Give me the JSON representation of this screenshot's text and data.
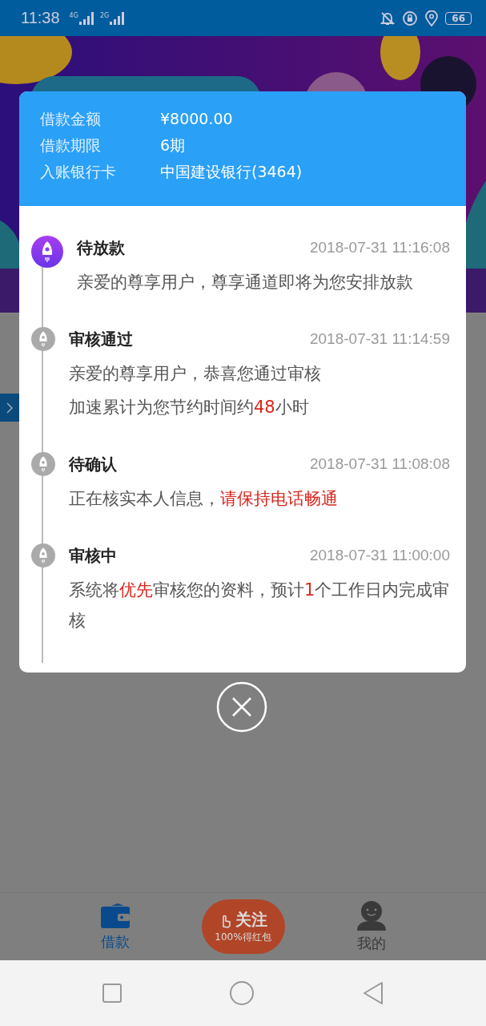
{
  "status_bar": {
    "time": "11:38",
    "signals": [
      "4G",
      "2G"
    ],
    "battery": "66"
  },
  "loan_dialog": {
    "summary": [
      {
        "label": "借款金额",
        "value": "¥8000.00"
      },
      {
        "label": "借款期限",
        "value": "6期"
      },
      {
        "label": "入账银行卡",
        "value": "中国建设银行(3464)"
      }
    ],
    "timeline": [
      {
        "title": "待放款",
        "time": "2018-07-31 11:16:08",
        "active": true,
        "lines": [
          [
            {
              "text": "亲爱的尊享用户，尊享通道即将为您安排放款",
              "highlight": false
            }
          ]
        ]
      },
      {
        "title": "审核通过",
        "time": "2018-07-31 11:14:59",
        "active": false,
        "lines": [
          [
            {
              "text": "亲爱的尊享用户，恭喜您通过审核",
              "highlight": false
            }
          ],
          [
            {
              "text": "加速累计为您节约时间约",
              "highlight": false
            },
            {
              "text": "48",
              "highlight": true
            },
            {
              "text": "小时",
              "highlight": false
            }
          ]
        ]
      },
      {
        "title": "待确认",
        "time": "2018-07-31 11:08:08",
        "active": false,
        "lines": [
          [
            {
              "text": "正在核实本人信息，",
              "highlight": false
            },
            {
              "text": "请保持电话畅通",
              "highlight": true
            }
          ]
        ]
      },
      {
        "title": "审核中",
        "time": "2018-07-31 11:00:00",
        "active": false,
        "lines": [
          [
            {
              "text": "系统将",
              "highlight": false
            },
            {
              "text": "优先",
              "highlight": true
            },
            {
              "text": "审核您的资料，预计",
              "highlight": false
            },
            {
              "text": "1",
              "highlight": true
            },
            {
              "text": "个工作日内完成审核",
              "highlight": false
            }
          ]
        ]
      }
    ]
  },
  "bottom_nav": {
    "tabs": [
      {
        "label": "借款",
        "selected": true
      },
      {
        "label": "我的",
        "selected": false
      }
    ],
    "promo": {
      "title": "关注",
      "subtitle": "100%得红包"
    }
  }
}
